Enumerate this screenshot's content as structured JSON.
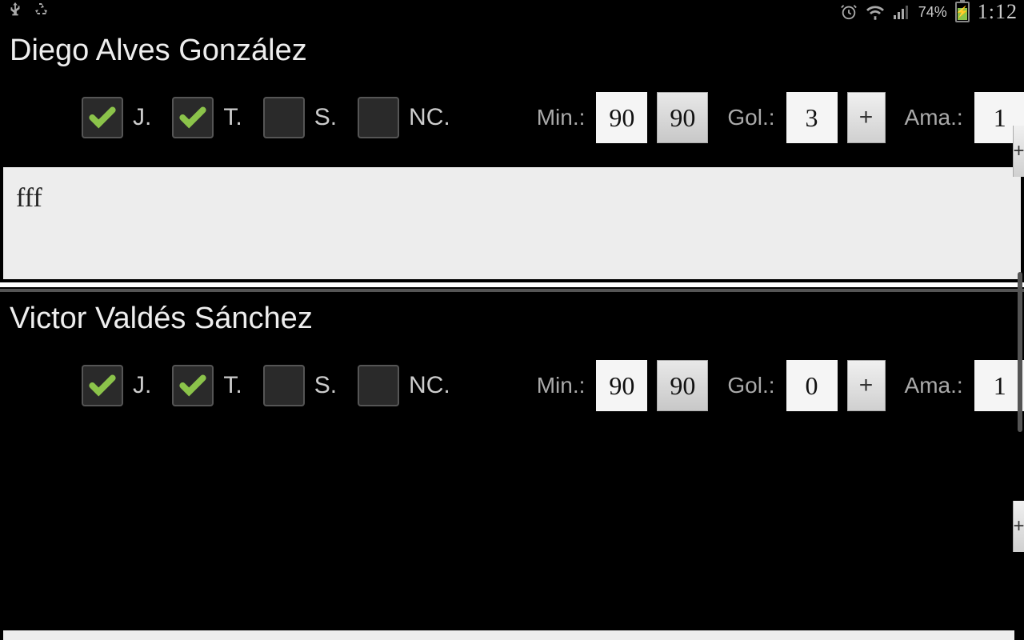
{
  "statusbar": {
    "battery_pct": "74%",
    "time": "1:12"
  },
  "checkbox_labels": {
    "j": "J.",
    "t": "T.",
    "s": "S.",
    "nc": "NC."
  },
  "stat_labels": {
    "min": "Min.:",
    "gol": "Gol.:",
    "ama": "Ama.:",
    "plus": "+"
  },
  "players": [
    {
      "name": "Diego Alves González",
      "checks": {
        "j": true,
        "t": true,
        "s": false,
        "nc": false
      },
      "min_value": "90",
      "min_default": "90",
      "gol": "3",
      "ama": "1",
      "note": "fff"
    },
    {
      "name": "Victor Valdés Sánchez",
      "checks": {
        "j": true,
        "t": true,
        "s": false,
        "nc": false
      },
      "min_value": "90",
      "min_default": "90",
      "gol": "0",
      "ama": "1",
      "note": ""
    }
  ]
}
